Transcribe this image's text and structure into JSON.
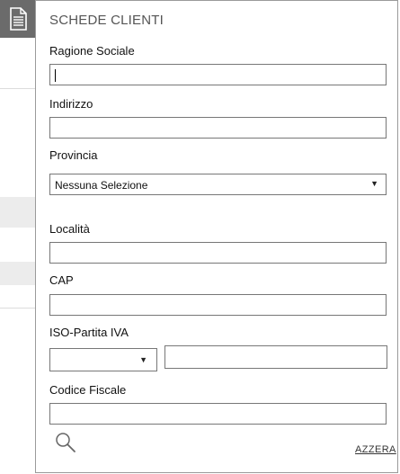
{
  "panel": {
    "title": "SCHEDE CLIENTI",
    "reset_label": "AZZERA"
  },
  "fields": {
    "ragione_sociale": {
      "label": "Ragione Sociale",
      "value": ""
    },
    "indirizzo": {
      "label": "Indirizzo",
      "value": ""
    },
    "provincia": {
      "label": "Provincia",
      "selected": "Nessuna Selezione"
    },
    "localita": {
      "label": "Località",
      "value": ""
    },
    "cap": {
      "label": "CAP",
      "value": ""
    },
    "iso_partita_iva": {
      "label": "ISO-Partita IVA",
      "iso_selected": "",
      "value": ""
    },
    "codice_fiscale": {
      "label": "Codice Fiscale",
      "value": ""
    }
  },
  "icons": {
    "sidebar": "document-icon",
    "search": "search-icon",
    "dropdown": "chevron-down-icon"
  },
  "colors": {
    "icon_tile": "#6b6b6b",
    "panel_border": "#9a9a9a",
    "input_border": "#777777"
  }
}
